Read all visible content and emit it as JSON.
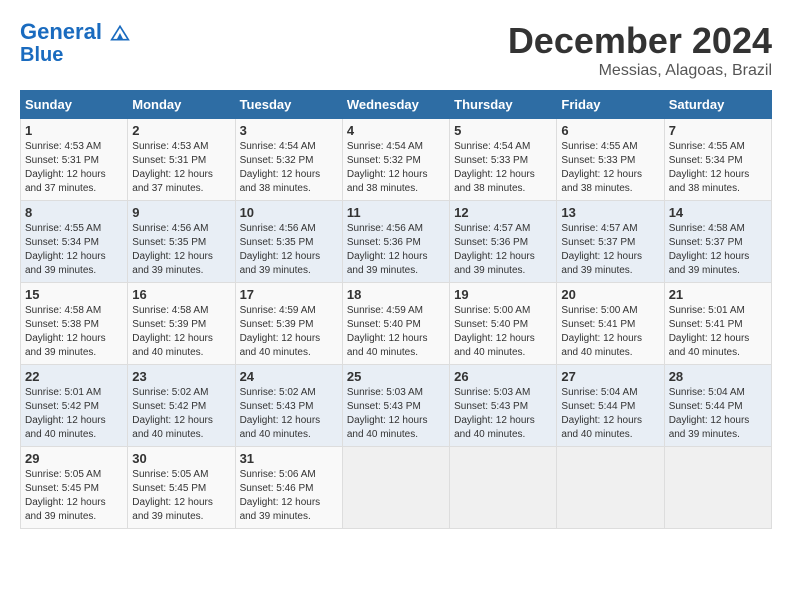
{
  "header": {
    "logo_line1": "General",
    "logo_line2": "Blue",
    "month": "December 2024",
    "location": "Messias, Alagoas, Brazil"
  },
  "weekdays": [
    "Sunday",
    "Monday",
    "Tuesday",
    "Wednesday",
    "Thursday",
    "Friday",
    "Saturday"
  ],
  "weeks": [
    [
      {
        "day": "1",
        "sunrise": "4:53 AM",
        "sunset": "5:31 PM",
        "daylight": "12 hours and 37 minutes."
      },
      {
        "day": "2",
        "sunrise": "4:53 AM",
        "sunset": "5:31 PM",
        "daylight": "12 hours and 37 minutes."
      },
      {
        "day": "3",
        "sunrise": "4:54 AM",
        "sunset": "5:32 PM",
        "daylight": "12 hours and 38 minutes."
      },
      {
        "day": "4",
        "sunrise": "4:54 AM",
        "sunset": "5:32 PM",
        "daylight": "12 hours and 38 minutes."
      },
      {
        "day": "5",
        "sunrise": "4:54 AM",
        "sunset": "5:33 PM",
        "daylight": "12 hours and 38 minutes."
      },
      {
        "day": "6",
        "sunrise": "4:55 AM",
        "sunset": "5:33 PM",
        "daylight": "12 hours and 38 minutes."
      },
      {
        "day": "7",
        "sunrise": "4:55 AM",
        "sunset": "5:34 PM",
        "daylight": "12 hours and 38 minutes."
      }
    ],
    [
      {
        "day": "8",
        "sunrise": "4:55 AM",
        "sunset": "5:34 PM",
        "daylight": "12 hours and 39 minutes."
      },
      {
        "day": "9",
        "sunrise": "4:56 AM",
        "sunset": "5:35 PM",
        "daylight": "12 hours and 39 minutes."
      },
      {
        "day": "10",
        "sunrise": "4:56 AM",
        "sunset": "5:35 PM",
        "daylight": "12 hours and 39 minutes."
      },
      {
        "day": "11",
        "sunrise": "4:56 AM",
        "sunset": "5:36 PM",
        "daylight": "12 hours and 39 minutes."
      },
      {
        "day": "12",
        "sunrise": "4:57 AM",
        "sunset": "5:36 PM",
        "daylight": "12 hours and 39 minutes."
      },
      {
        "day": "13",
        "sunrise": "4:57 AM",
        "sunset": "5:37 PM",
        "daylight": "12 hours and 39 minutes."
      },
      {
        "day": "14",
        "sunrise": "4:58 AM",
        "sunset": "5:37 PM",
        "daylight": "12 hours and 39 minutes."
      }
    ],
    [
      {
        "day": "15",
        "sunrise": "4:58 AM",
        "sunset": "5:38 PM",
        "daylight": "12 hours and 39 minutes."
      },
      {
        "day": "16",
        "sunrise": "4:58 AM",
        "sunset": "5:39 PM",
        "daylight": "12 hours and 40 minutes."
      },
      {
        "day": "17",
        "sunrise": "4:59 AM",
        "sunset": "5:39 PM",
        "daylight": "12 hours and 40 minutes."
      },
      {
        "day": "18",
        "sunrise": "4:59 AM",
        "sunset": "5:40 PM",
        "daylight": "12 hours and 40 minutes."
      },
      {
        "day": "19",
        "sunrise": "5:00 AM",
        "sunset": "5:40 PM",
        "daylight": "12 hours and 40 minutes."
      },
      {
        "day": "20",
        "sunrise": "5:00 AM",
        "sunset": "5:41 PM",
        "daylight": "12 hours and 40 minutes."
      },
      {
        "day": "21",
        "sunrise": "5:01 AM",
        "sunset": "5:41 PM",
        "daylight": "12 hours and 40 minutes."
      }
    ],
    [
      {
        "day": "22",
        "sunrise": "5:01 AM",
        "sunset": "5:42 PM",
        "daylight": "12 hours and 40 minutes."
      },
      {
        "day": "23",
        "sunrise": "5:02 AM",
        "sunset": "5:42 PM",
        "daylight": "12 hours and 40 minutes."
      },
      {
        "day": "24",
        "sunrise": "5:02 AM",
        "sunset": "5:43 PM",
        "daylight": "12 hours and 40 minutes."
      },
      {
        "day": "25",
        "sunrise": "5:03 AM",
        "sunset": "5:43 PM",
        "daylight": "12 hours and 40 minutes."
      },
      {
        "day": "26",
        "sunrise": "5:03 AM",
        "sunset": "5:43 PM",
        "daylight": "12 hours and 40 minutes."
      },
      {
        "day": "27",
        "sunrise": "5:04 AM",
        "sunset": "5:44 PM",
        "daylight": "12 hours and 40 minutes."
      },
      {
        "day": "28",
        "sunrise": "5:04 AM",
        "sunset": "5:44 PM",
        "daylight": "12 hours and 39 minutes."
      }
    ],
    [
      {
        "day": "29",
        "sunrise": "5:05 AM",
        "sunset": "5:45 PM",
        "daylight": "12 hours and 39 minutes."
      },
      {
        "day": "30",
        "sunrise": "5:05 AM",
        "sunset": "5:45 PM",
        "daylight": "12 hours and 39 minutes."
      },
      {
        "day": "31",
        "sunrise": "5:06 AM",
        "sunset": "5:46 PM",
        "daylight": "12 hours and 39 minutes."
      },
      null,
      null,
      null,
      null
    ]
  ]
}
